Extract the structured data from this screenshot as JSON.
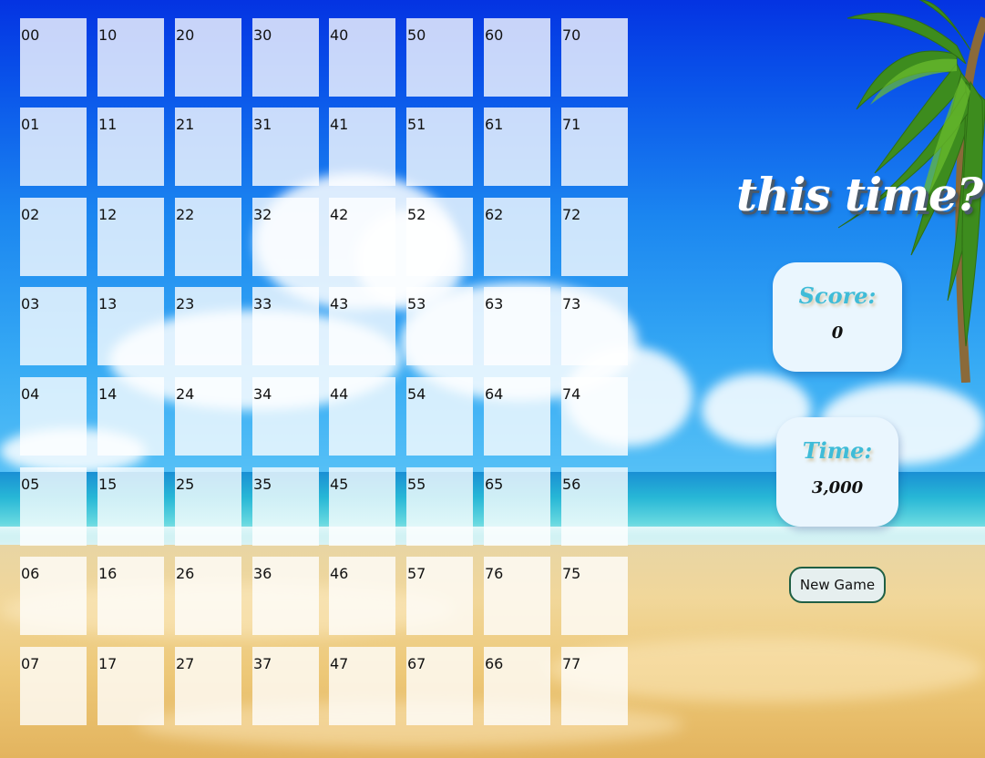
{
  "title": "this time?",
  "score": {
    "label": "Score:",
    "value": "0"
  },
  "time": {
    "label": "Time:",
    "value": "3,000"
  },
  "new_game_label": "New Game",
  "tiles": [
    [
      "00",
      "10",
      "20",
      "30",
      "40",
      "50",
      "60",
      "70"
    ],
    [
      "01",
      "11",
      "21",
      "31",
      "41",
      "51",
      "61",
      "71"
    ],
    [
      "02",
      "12",
      "22",
      "32",
      "42",
      "52",
      "62",
      "72"
    ],
    [
      "03",
      "13",
      "23",
      "33",
      "43",
      "53",
      "63",
      "73"
    ],
    [
      "04",
      "14",
      "24",
      "34",
      "44",
      "54",
      "64",
      "74"
    ],
    [
      "05",
      "15",
      "25",
      "35",
      "45",
      "55",
      "65",
      "56"
    ],
    [
      "06",
      "16",
      "26",
      "36",
      "46",
      "57",
      "76",
      "75"
    ],
    [
      "07",
      "17",
      "27",
      "37",
      "47",
      "67",
      "66",
      "77"
    ]
  ],
  "colors": {
    "title_shadow": "#4a5a6a",
    "panel_bg": "#eaf6fe",
    "panel_label": "#3fbcd8",
    "button_border": "#1f5f44"
  }
}
